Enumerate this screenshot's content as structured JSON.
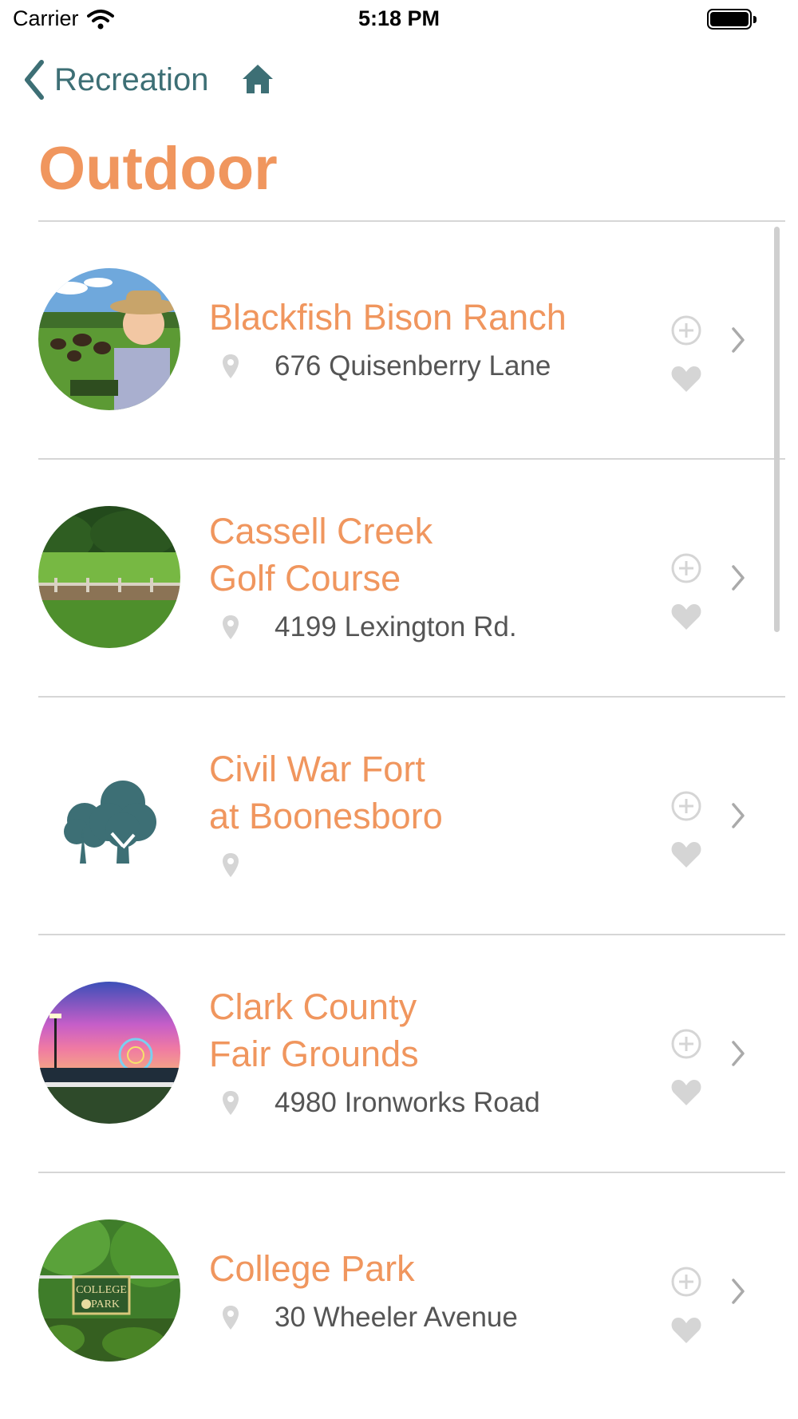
{
  "status_bar": {
    "carrier": "Carrier",
    "time": "5:18 PM"
  },
  "nav": {
    "back_label": "Recreation"
  },
  "page": {
    "title": "Outdoor"
  },
  "colors": {
    "accent_orange": "#f0965e",
    "teal": "#3d6f75",
    "icon_gray": "#d5d5d5"
  },
  "items": [
    {
      "name": "Blackfish Bison Ranch",
      "address": "676 Quisenberry Lane"
    },
    {
      "name": "Cassell Creek\nGolf Course",
      "address": "4199 Lexington Rd."
    },
    {
      "name": "Civil War Fort\nat Boonesboro",
      "address": ""
    },
    {
      "name": "Clark County\nFair Grounds",
      "address": "4980 Ironworks Road"
    },
    {
      "name": "College Park",
      "address": "30 Wheeler Avenue"
    }
  ],
  "thumb_text": {
    "college_sign_line1": "COLLEGE",
    "college_sign_line2": "PARK"
  }
}
